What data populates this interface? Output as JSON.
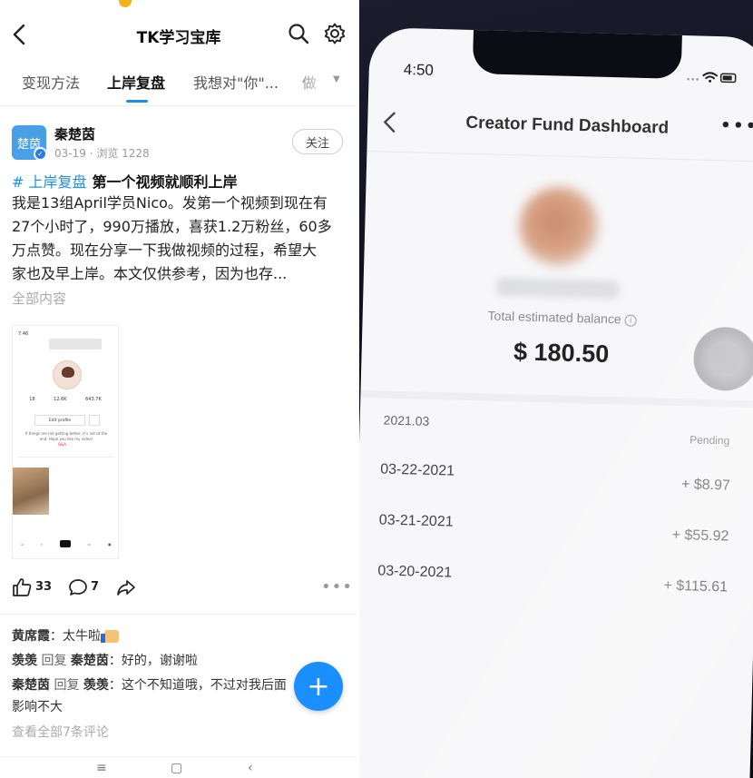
{
  "left": {
    "header": {
      "title": "TK学习宝库"
    },
    "tabs": [
      {
        "label": "变现方法"
      },
      {
        "label": "上岸复盘"
      },
      {
        "label": "我想对\"你\"..."
      },
      {
        "label": "做"
      }
    ],
    "post": {
      "author_avatar_text": "楚茵",
      "author_name": "秦楚茵",
      "meta": "03-19 · 浏览 1228",
      "follow_label": "关注",
      "tag": "# 上岸复盘",
      "headline": "第一个视频就顺利上岸",
      "body_lines": [
        "我是13组April学员Nico。发第一个视频到现在有",
        "27个小时了，990万播放，喜获1.2万粉丝，60多",
        "万点赞。现在分享一下我做视频的过程，希望大",
        "家也及早上岸。本文仅供参考，因为也存..."
      ],
      "read_more": "全部内容",
      "screenshot": {
        "time": "7:46",
        "stats": [
          "18",
          "12.6K",
          "643.7K"
        ],
        "edit_profile": "Edit profile",
        "bio": "If things are not getting better, it's not at the end. Hope you like my video!",
        "qa": "Q&A"
      },
      "likes": "33",
      "comments": "7"
    },
    "comments": [
      {
        "user": "黄席霞",
        "text": "：太牛啦"
      },
      {
        "user": "羡羡",
        "reply_word": "回复",
        "to": "秦楚茵",
        "text": "：好的，谢谢啦"
      },
      {
        "user": "秦楚茵",
        "reply_word": "回复",
        "to": "羡羡",
        "text": "：这个不知道哦，不过对我后面",
        "text2": "影响不大"
      }
    ],
    "see_all": "查看全部7条评论"
  },
  "right": {
    "time": "4:50",
    "title": "Creator Fund Dashboard",
    "balance_label": "Total estimated balance",
    "balance": "$ 180.50",
    "month": "2021.03",
    "pending": "Pending",
    "rows": [
      {
        "date": "03-22-2021",
        "amount": "+ $8.97"
      },
      {
        "date": "03-21-2021",
        "amount": "+ $55.92"
      },
      {
        "date": "03-20-2021",
        "amount": "+ $115.61"
      }
    ]
  }
}
